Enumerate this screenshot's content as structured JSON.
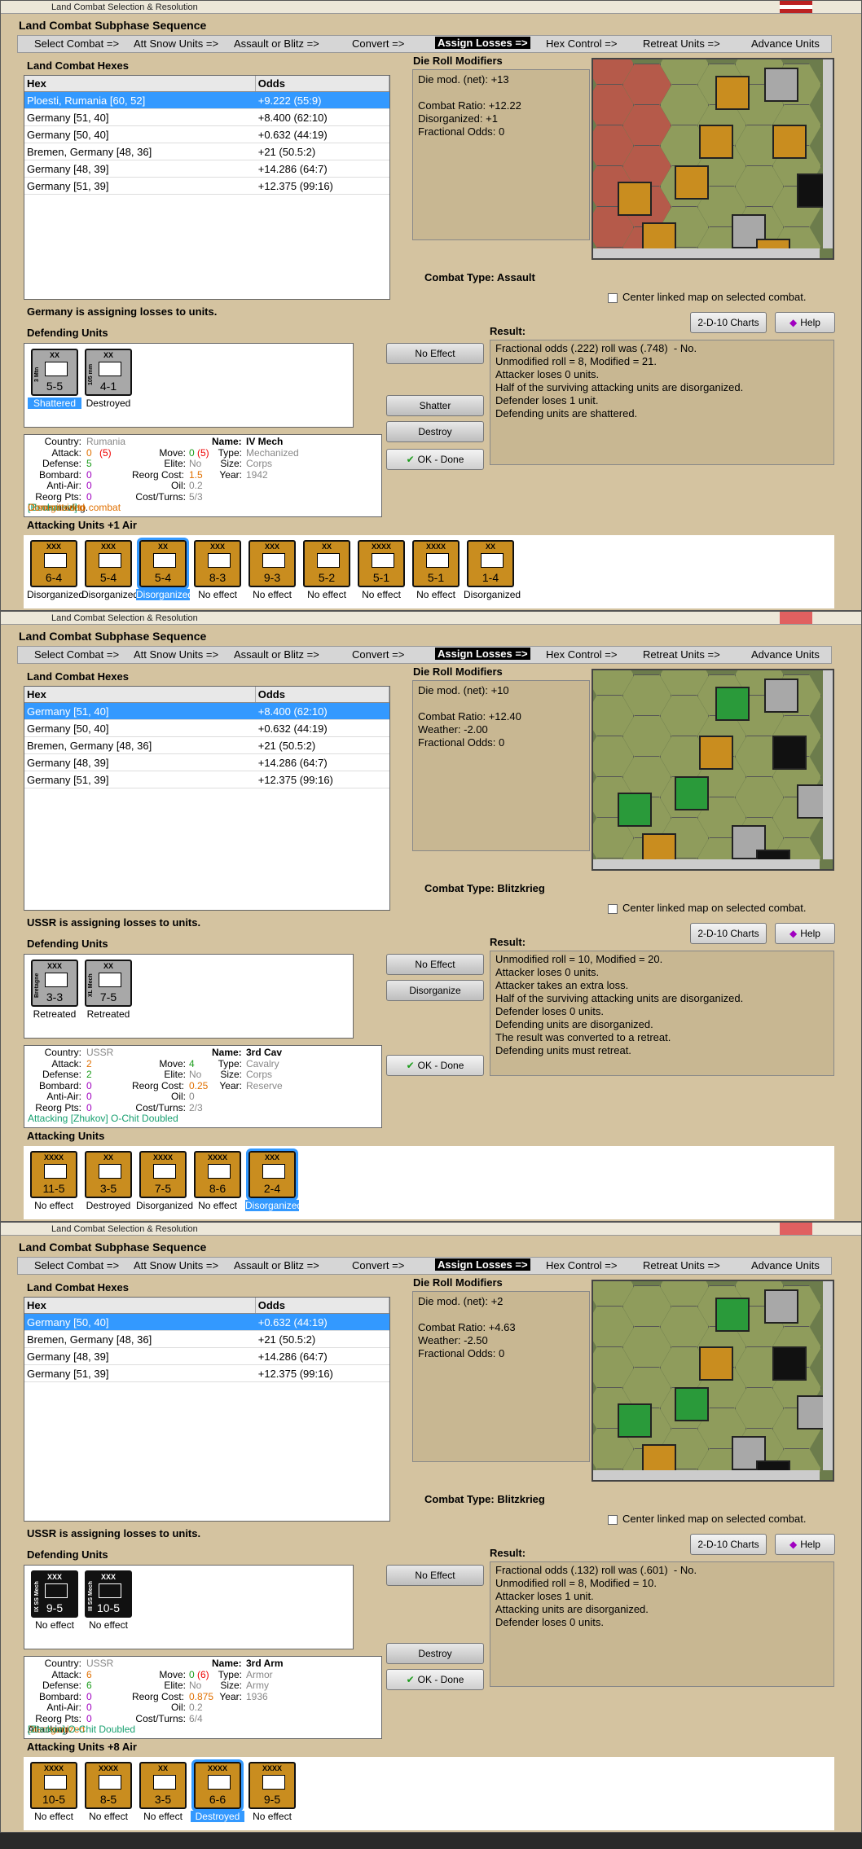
{
  "window_title": "Land Combat Selection & Resolution",
  "sequence_title": "Land Combat Subphase Sequence",
  "phases": [
    "Select Combat =>",
    "Att Snow Units =>",
    "Assault or Blitz =>",
    "Convert =>",
    "Assign Losses =>",
    "Hex Control =>",
    "Retreat Units =>",
    "Advance Units"
  ],
  "labels": {
    "hexes": "Land Combat Hexes",
    "hex_col": "Hex",
    "odds_col": "Odds",
    "drm": "Die Roll Modifiers",
    "combat_type_label": "Combat Type:",
    "center_map": "Center linked map on selected combat.",
    "defending": "Defending Units",
    "result": "Result:",
    "charts": "2-D-10 Charts",
    "help": "Help",
    "ok": "OK - Done"
  },
  "panels": [
    {
      "rows": [
        [
          "Ploesti, Rumania [60, 52]",
          "+9.222 (55:9)"
        ],
        [
          "Germany [51, 40]",
          "+8.400 (62:10)"
        ],
        [
          "Germany [50, 40]",
          "+0.632 (44:19)"
        ],
        [
          "Bremen, Germany [48, 36]",
          "+21 (50.5:2)"
        ],
        [
          "Germany [48, 39]",
          "+14.286 (64:7)"
        ],
        [
          "Germany [51, 39]",
          "+12.375 (99:16)"
        ]
      ],
      "drm": "Die mod. (net): +13\n\nCombat Ratio: +12.22\nDisorganized: +1\nFractional Odds: 0",
      "combat_type": "Assault",
      "assigning": "Germany is assigning losses to units.",
      "buttons": [
        "No Effect",
        "Shatter",
        "Destroy"
      ],
      "result": "Fractional odds (.222) roll was (.748)  - No.\nUnmodified roll = 8, Modified = 21.\nAttacker loses 0 units.\nHalf of the surviving attacking units are disorganized.\nDefender loses 1 unit.\nDefending units are shattered.",
      "attacking_label": "Attacking Units +1 Air",
      "defenders": [
        {
          "str": "5-5",
          "sz": "XX",
          "nm": "3 Mtn",
          "tag": "Shattered",
          "color": "grey",
          "sel": true
        },
        {
          "str": "4-1",
          "sz": "XX",
          "nm": "105 mm",
          "tag": "Destroyed",
          "color": "grey",
          "sel": false
        }
      ],
      "info": {
        "country": "Rumania",
        "attack": "0",
        "attack_b": "(5)",
        "defense": "5",
        "bombard": "0",
        "antiair": "0",
        "reorg": "0",
        "name": "IV Mech",
        "move": "0",
        "move_b": "(5)",
        "type": "Mechanized",
        "elite": "No",
        "size": "Corps",
        "reorg_cost": "1.5",
        "oil": "0.2",
        "year": "1942",
        "cost_turns": "5/3",
        "footer1": "Done moving.",
        "footer2": "Disorganized",
        "footer3": "[Bucharest]",
        "footer4": "Committed to combat"
      },
      "attackers": [
        {
          "str": "6-4",
          "sz": "XXX",
          "tag": "Disorganized",
          "sel": false
        },
        {
          "str": "5-4",
          "sz": "XXX",
          "tag": "Disorganized",
          "sel": false
        },
        {
          "str": "5-4",
          "sz": "XX",
          "tag": "Disorganized",
          "sel": true
        },
        {
          "str": "8-3",
          "sz": "XXX",
          "tag": "No effect",
          "sel": false
        },
        {
          "str": "9-3",
          "sz": "XXX",
          "tag": "No effect",
          "sel": false
        },
        {
          "str": "5-2",
          "sz": "XX",
          "tag": "No effect",
          "sel": false
        },
        {
          "str": "5-1",
          "sz": "XXXX",
          "tag": "No effect",
          "sel": false
        },
        {
          "str": "5-1",
          "sz": "XXXX",
          "tag": "No effect",
          "sel": false
        },
        {
          "str": "1-4",
          "sz": "XX",
          "tag": "Disorganized",
          "sel": false
        }
      ]
    },
    {
      "rows": [
        [
          "Germany [51, 40]",
          "+8.400 (62:10)"
        ],
        [
          "Germany [50, 40]",
          "+0.632 (44:19)"
        ],
        [
          "Bremen, Germany [48, 36]",
          "+21 (50.5:2)"
        ],
        [
          "Germany [48, 39]",
          "+14.286 (64:7)"
        ],
        [
          "Germany [51, 39]",
          "+12.375 (99:16)"
        ]
      ],
      "drm": "Die mod. (net): +10\n\nCombat Ratio: +12.40\nWeather: -2.00\nFractional Odds: 0",
      "combat_type": "Blitzkrieg",
      "assigning": "USSR is assigning losses to units.",
      "buttons": [
        "No Effect",
        "Disorganize"
      ],
      "result": "Unmodified roll = 10, Modified = 20.\nAttacker loses 0 units.\nAttacker takes an extra loss.\nHalf of the surviving attacking units are disorganized.\nDefender loses 0 units.\nDefending units are disorganized.\nThe result was converted to a retreat.\nDefending units must retreat.",
      "attacking_label": "Attacking Units",
      "defenders": [
        {
          "str": "3-3",
          "sz": "XXX",
          "nm": "Bretagne",
          "tag": "Retreated",
          "color": "grey",
          "sel": false
        },
        {
          "str": "7-5",
          "sz": "XX",
          "nm": "XL Mech",
          "tag": "Retreated",
          "color": "grey",
          "sel": false
        }
      ],
      "info": {
        "country": "USSR",
        "attack": "2",
        "attack_b": "",
        "defense": "2",
        "bombard": "0",
        "antiair": "0",
        "reorg": "0",
        "name": "3rd Cav",
        "move": "4",
        "move_b": "",
        "type": "Cavalry",
        "elite": "No",
        "size": "Corps",
        "reorg_cost": "0.25",
        "oil": "0",
        "year": "Reserve",
        "cost_turns": "2/3",
        "footer1": "Attacking [Zhukov] O-Chit Doubled",
        "footer2": "",
        "footer3": "",
        "footer4": ""
      },
      "attackers": [
        {
          "str": "11-5",
          "sz": "XXXX",
          "tag": "No effect",
          "sel": false
        },
        {
          "str": "3-5",
          "sz": "XX",
          "tag": "Destroyed",
          "sel": false
        },
        {
          "str": "7-5",
          "sz": "XXXX",
          "tag": "Disorganized",
          "sel": false
        },
        {
          "str": "8-6",
          "sz": "XXXX",
          "tag": "No effect",
          "sel": false
        },
        {
          "str": "2-4",
          "sz": "XXX",
          "tag": "Disorganized",
          "sel": true
        }
      ]
    },
    {
      "rows": [
        [
          "Germany [50, 40]",
          "+0.632 (44:19)"
        ],
        [
          "Bremen, Germany [48, 36]",
          "+21 (50.5:2)"
        ],
        [
          "Germany [48, 39]",
          "+14.286 (64:7)"
        ],
        [
          "Germany [51, 39]",
          "+12.375 (99:16)"
        ]
      ],
      "drm": "Die mod. (net): +2\n\nCombat Ratio: +4.63\nWeather: -2.50\nFractional Odds: 0",
      "combat_type": "Blitzkrieg",
      "assigning": "USSR is assigning losses to units.",
      "buttons": [
        "No Effect",
        "Destroy"
      ],
      "result": "Fractional odds (.132) roll was (.601)  - No.\nUnmodified roll = 8, Modified = 10.\nAttacker loses 1 unit.\nAttacking units are disorganized.\nDefender loses 0 units.",
      "attacking_label": "Attacking Units +8 Air",
      "defenders": [
        {
          "str": "9-5",
          "sz": "XXX",
          "nm": "IX SS Mech",
          "tag": "No effect",
          "color": "black",
          "sel": false
        },
        {
          "str": "10-5",
          "sz": "XXX",
          "nm": "III SS Mech",
          "tag": "No effect",
          "color": "black",
          "sel": false
        }
      ],
      "info": {
        "country": "USSR",
        "attack": "6",
        "attack_b": "",
        "defense": "6",
        "bombard": "0",
        "antiair": "0",
        "reorg": "0",
        "name": "3rd Arm",
        "move": "0",
        "move_b": "(6)",
        "type": "Armor",
        "elite": "No",
        "size": "Army",
        "reorg_cost": "0.875",
        "oil": "0.2",
        "year": "1936",
        "cost_turns": "6/4",
        "footer1": "Attacking",
        "footer2": "Disorganized",
        "footer3": "[Zhukov] O-Chit Doubled",
        "footer4": ""
      },
      "attackers": [
        {
          "str": "10-5",
          "sz": "XXXX",
          "tag": "No effect",
          "sel": false
        },
        {
          "str": "8-5",
          "sz": "XXXX",
          "tag": "No effect",
          "sel": false
        },
        {
          "str": "3-5",
          "sz": "XX",
          "tag": "No effect",
          "sel": false
        },
        {
          "str": "6-6",
          "sz": "XXXX",
          "tag": "Destroyed",
          "sel": true
        },
        {
          "str": "9-5",
          "sz": "XXXX",
          "tag": "No effect",
          "sel": false
        }
      ]
    }
  ],
  "info_labels": {
    "country": "Country:",
    "attack": "Attack:",
    "defense": "Defense:",
    "bombard": "Bombard:",
    "antiair": "Anti-Air:",
    "reorg": "Reorg Pts:",
    "name": "Name:",
    "move": "Move:",
    "type": "Type:",
    "elite": "Elite:",
    "size": "Size:",
    "reorg_cost": "Reorg Cost:",
    "oil": "Oil:",
    "year": "Year:",
    "cost_turns": "Cost/Turns:"
  }
}
